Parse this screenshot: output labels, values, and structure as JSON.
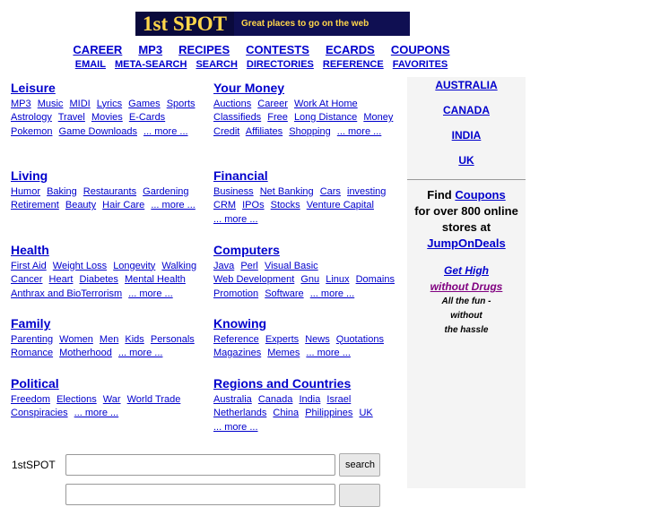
{
  "logo": {
    "name": "1st SPOT",
    "tagline": "Great places to go on the web"
  },
  "nav1": [
    "CAREER",
    "MP3",
    "RECIPES",
    "CONTESTS",
    "ECARDS",
    "COUPONS"
  ],
  "nav2": [
    "EMAIL",
    "META-SEARCH",
    "SEARCH",
    "DIRECTORIES",
    "REFERENCE",
    "FAVORITES"
  ],
  "categories": {
    "leisure": {
      "title": "Leisure",
      "links": [
        "MP3",
        "Music",
        "MIDI",
        "Lyrics",
        "Games",
        "Sports",
        "Astrology",
        "Travel",
        "Movies",
        "E-Cards",
        "Pokemon",
        "Game Downloads",
        "... more ..."
      ]
    },
    "money": {
      "title": "Your Money",
      "links": [
        "Auctions",
        "Career",
        "Work At Home",
        "Classifieds",
        "Free",
        "Long Distance",
        "Money",
        "Credit",
        "Affiliates",
        "Shopping",
        "... more ..."
      ]
    },
    "living": {
      "title": "Living",
      "links": [
        "Humor",
        "Baking",
        "Restaurants",
        "Gardening",
        "Retirement",
        "Beauty",
        "Hair Care",
        "... more ..."
      ]
    },
    "financial": {
      "title": "Financial",
      "links": [
        "Business",
        "Net Banking",
        "Cars",
        "investing",
        "CRM",
        "IPOs",
        "Stocks",
        "Venture Capital",
        "... more ..."
      ]
    },
    "health": {
      "title": "Health",
      "links": [
        "First Aid",
        "Weight Loss",
        "Longevity",
        "Walking",
        "Cancer",
        "Heart",
        "Diabetes",
        "Mental Health",
        "Anthrax and BioTerrorism",
        "... more ..."
      ]
    },
    "computers": {
      "title": "Computers",
      "links": [
        "Java",
        "Perl",
        "Visual Basic",
        "Web Development",
        "Gnu",
        "Linux",
        "Domains",
        "Promotion",
        "Software",
        "... more ..."
      ]
    },
    "family": {
      "title": "Family",
      "links": [
        "Parenting",
        "Women",
        "Men",
        "Kids",
        "Personals",
        "Romance",
        "Motherhood",
        "... more ..."
      ]
    },
    "knowing": {
      "title": "Knowing",
      "links": [
        "Reference",
        "Experts",
        "News",
        "Quotations",
        "Magazines",
        "Memes",
        "... more ..."
      ]
    },
    "political": {
      "title": "Political",
      "links": [
        "Freedom",
        "Elections",
        "War",
        "World Trade",
        "Conspiracies",
        "... more ..."
      ]
    },
    "regions": {
      "title": "Regions and Countries",
      "links": [
        "Australia",
        "Canada",
        "India",
        "Israel",
        "Netherlands",
        "China",
        "Philippines",
        "UK",
        "... more ..."
      ]
    }
  },
  "sidebar": {
    "countries": [
      "AUSTRALIA",
      "CANADA",
      "INDIA",
      "UK"
    ],
    "coupon_find": "Find",
    "coupon_link": "Coupons",
    "coupon_rest": "for over 800 online stores at",
    "coupon_site": "JumpOnDeals",
    "gethigh1": "Get High",
    "gethigh2": "without Drugs",
    "gethigh_sub1": "All the fun -",
    "gethigh_sub2": "without",
    "gethigh_sub3": "the hassle"
  },
  "search": {
    "label": "1stSPOT",
    "button": "search",
    "value": ""
  },
  "colors": {
    "link": "#0000cc",
    "visited": "#800080",
    "sidebar_bg": "#f4f4f4"
  }
}
